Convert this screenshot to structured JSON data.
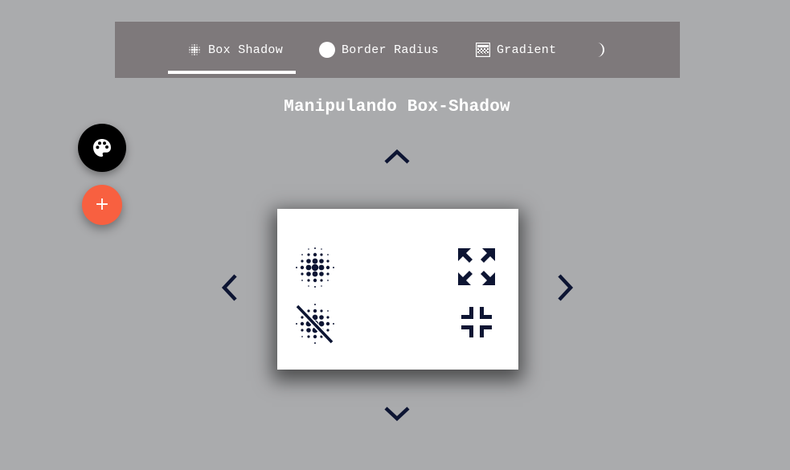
{
  "nav": {
    "tabs": [
      {
        "label": "Box Shadow",
        "icon": "halftone-icon",
        "active": true
      },
      {
        "label": "Border Radius",
        "icon": "circle-icon",
        "active": false
      },
      {
        "label": "Gradient",
        "icon": "gradient-icon",
        "active": false
      },
      {
        "label": "",
        "icon": "moon-icon",
        "active": false
      }
    ]
  },
  "page": {
    "title": "Manipulando Box-Shadow"
  },
  "fab": {
    "palette_icon": "palette-icon",
    "add_label": "+"
  },
  "colors": {
    "background": "#aaabad",
    "nav_background": "#7e797b",
    "accent_add": "#f86040",
    "icon_dark": "#0d1533"
  },
  "controls": [
    "arrow-up",
    "arrow-down",
    "arrow-left",
    "arrow-right",
    "shadow-on",
    "shadow-off",
    "expand",
    "shrink"
  ]
}
